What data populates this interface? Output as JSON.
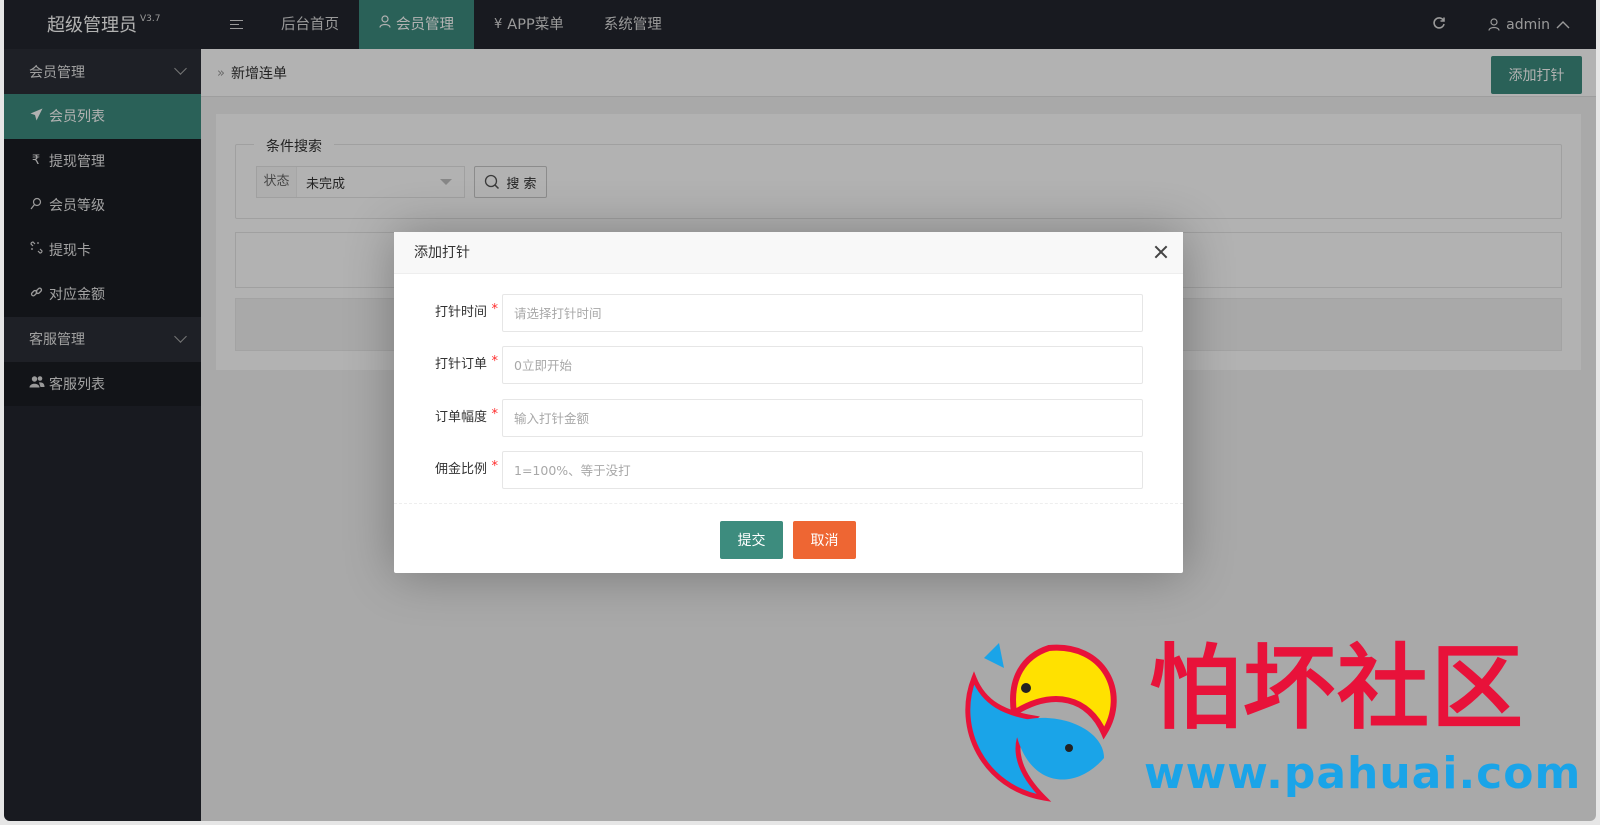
{
  "app": {
    "title": "超级管理员",
    "version": "V3.7"
  },
  "header": {
    "nav": [
      {
        "label": "后台首页",
        "icon": ""
      },
      {
        "label": "会员管理",
        "icon": "user-icon",
        "active": true
      },
      {
        "label": "APP菜单",
        "icon": "yen-icon"
      },
      {
        "label": "系统管理",
        "icon": ""
      }
    ],
    "user": "admin"
  },
  "sidebar": {
    "groups": [
      {
        "label": "会员管理",
        "items": [
          {
            "label": "会员列表",
            "icon": "rocket-icon",
            "active": true
          },
          {
            "label": "提现管理",
            "icon": "rupee-icon"
          },
          {
            "label": "会员等级",
            "icon": "female-icon"
          },
          {
            "label": "提现卡",
            "icon": "unlink-icon"
          },
          {
            "label": "对应金额",
            "icon": "link-icon"
          }
        ]
      },
      {
        "label": "客服管理",
        "items": [
          {
            "label": "客服列表",
            "icon": "users-icon"
          }
        ]
      }
    ]
  },
  "main": {
    "breadcrumb": "新增连单",
    "add_button": "添加打针",
    "search": {
      "legend": "条件搜索",
      "status_label": "状态",
      "status_value": "未完成",
      "search_button": "搜 索"
    }
  },
  "modal": {
    "title": "添加打针",
    "fields": [
      {
        "label": "打针时间",
        "placeholder": "请选择打针时间",
        "value": ""
      },
      {
        "label": "打针订单",
        "placeholder": "0立即开始",
        "value": ""
      },
      {
        "label": "订单幅度",
        "placeholder": "输入打针金额",
        "value": ""
      },
      {
        "label": "佣金比例",
        "placeholder": "1=100%、等于没打",
        "value": ""
      }
    ],
    "submit": "提交",
    "cancel": "取消"
  },
  "watermark": {
    "text": "怕坏社区",
    "url": "www.pahuai.com"
  },
  "colors": {
    "accent": "#3d8c7e",
    "dark": "#23262e",
    "cancel": "#ee6633",
    "required": "#ff2a2a"
  }
}
